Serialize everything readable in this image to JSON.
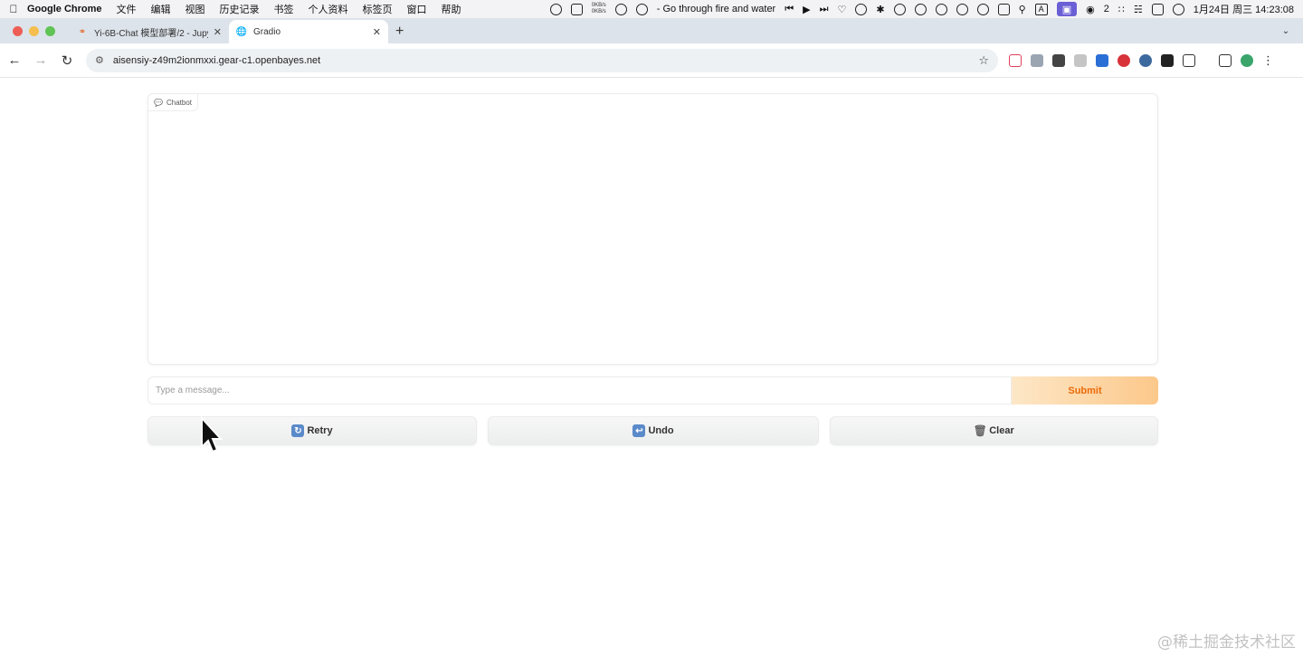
{
  "menubar": {
    "app_name": "Google Chrome",
    "menu_items": [
      "文件",
      "编辑",
      "视图",
      "历史记录",
      "书签",
      "个人资料",
      "标签页",
      "窗口",
      "帮助"
    ],
    "net_up": "0KB/s",
    "net_down": "0KB/s",
    "now_playing": "- Go through fire and water",
    "wechat_count": "2",
    "datetime": "1月24日 周三  14:23:08",
    "input_method": "A"
  },
  "tabs": [
    {
      "title": "Yi-6B-Chat 模型部署/2 - Jupy",
      "icon": "jupyter-icon"
    },
    {
      "title": "Gradio",
      "icon": "globe-icon"
    }
  ],
  "toolbar": {
    "url": "aisensiy-z49m2ionmxxi.gear-c1.openbayes.net"
  },
  "gradio": {
    "chatbot_label": "Chatbot",
    "input_placeholder": "Type a message...",
    "submit_label": "Submit",
    "retry_label": "Retry",
    "undo_label": "Undo",
    "clear_label": "Clear"
  },
  "watermark": "@稀土掘金技术社区",
  "colors": {
    "submit_text": "#ea6a0a",
    "submit_gradient_start": "#fde7c7",
    "submit_gradient_end": "#fcc88a"
  }
}
